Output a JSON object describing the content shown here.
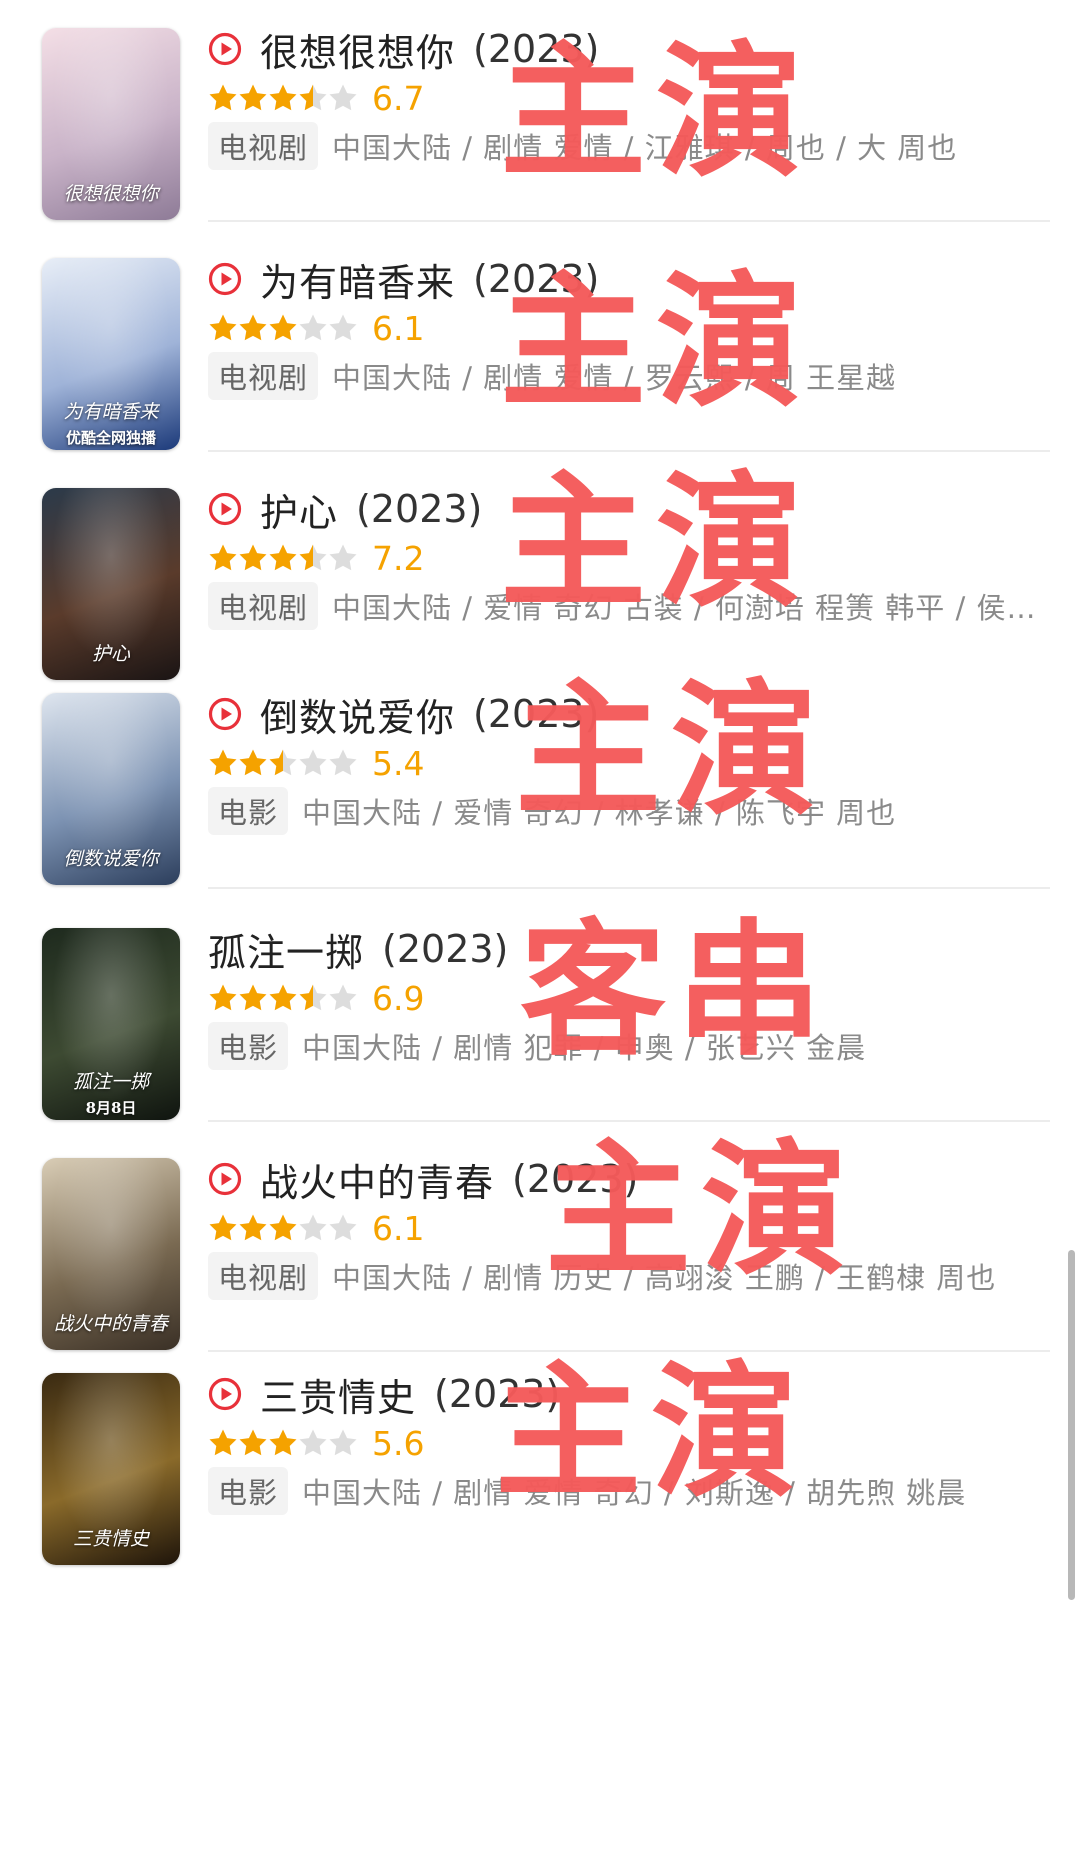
{
  "star_color": "#f5a200",
  "empty_star_color": "#dddddd",
  "stamp_color": "#f45a5a",
  "items": [
    {
      "title": "很想很想你",
      "year": "(2023)",
      "play_icon": true,
      "rating": 6.7,
      "rating_label": "6.7",
      "stars_filled": 3.5,
      "type_tag": "电视剧",
      "meta": "中国大陆 / 剧情 爱情 / 江雅琪 / 周也 / 大 周也",
      "stamp": "主演",
      "poster": {
        "text": "很想很想你",
        "colors": [
          "#f4dfe6",
          "#c9b3c8",
          "#8e7b97"
        ]
      }
    },
    {
      "title": "为有暗香来",
      "year": "(2023)",
      "play_icon": true,
      "rating": 6.1,
      "rating_label": "6.1",
      "stars_filled": 3,
      "type_tag": "电视剧",
      "meta": "中国大陆 / 剧情 爱情 / 罗云熙 / 周 王星越",
      "stamp": "主演",
      "poster": {
        "text": "为有暗香来",
        "colors": [
          "#e8eef7",
          "#9fb3d8",
          "#1c3a7a"
        ],
        "caption": "优酷全网独播"
      }
    },
    {
      "title": "护心",
      "year": "(2023)",
      "play_icon": true,
      "rating": 7.2,
      "rating_label": "7.2",
      "stars_filled": 3.5,
      "type_tag": "电视剧",
      "meta": "中国大陆 / 爱情 奇幻 古装 / 何澍培 程箦 韩平 / 侯…",
      "stamp": "主演",
      "poster": {
        "text": "护心",
        "colors": [
          "#2b3a4a",
          "#5a3b2b",
          "#1a1414"
        ]
      }
    },
    {
      "title": "倒数说爱你",
      "year": "(2023)",
      "play_icon": true,
      "rating": 5.4,
      "rating_label": "5.4",
      "stars_filled": 2.5,
      "type_tag": "电影",
      "meta": "中国大陆 / 爱情 奇幻 / 林孝谦 / 陈飞宇 周也",
      "stamp": "主演",
      "poster": {
        "text": "倒数说爱你",
        "colors": [
          "#dfe6ef",
          "#7d93b3",
          "#2c3e5c"
        ]
      }
    },
    {
      "title": "孤注一掷",
      "year": "(2023)",
      "play_icon": false,
      "rating": 6.9,
      "rating_label": "6.9",
      "stars_filled": 3.5,
      "type_tag": "电影",
      "meta": "中国大陆 / 剧情 犯罪 / 申奥 / 张艺兴 金晨",
      "stamp": "客串",
      "poster": {
        "text": "孤注一掷",
        "colors": [
          "#1e2a1e",
          "#3d4a32",
          "#0f140f"
        ],
        "caption": "8月8日"
      }
    },
    {
      "title": "战火中的青春",
      "year": "(2023)",
      "play_icon": true,
      "rating": 6.1,
      "rating_label": "6.1",
      "stars_filled": 3,
      "type_tag": "电视剧",
      "meta": "中国大陆 / 剧情 历史 / 高翊浚 王鹏 / 王鹤棣 周也",
      "stamp": "主演",
      "poster": {
        "text": "战火中的青春",
        "colors": [
          "#d9cdb6",
          "#7a6a52",
          "#3a3026"
        ]
      }
    },
    {
      "title": "三贵情史",
      "year": "(2023)",
      "play_icon": true,
      "rating": 5.6,
      "rating_label": "5.6",
      "stars_filled": 3,
      "type_tag": "电影",
      "meta": "中国大陆 / 剧情 爱情 奇幻 / 刘斯逸 / 胡先煦 姚晨",
      "stamp": "主演",
      "poster": {
        "text": "三贵情史",
        "colors": [
          "#3a2a12",
          "#8a6a2a",
          "#1e140a"
        ]
      }
    }
  ]
}
